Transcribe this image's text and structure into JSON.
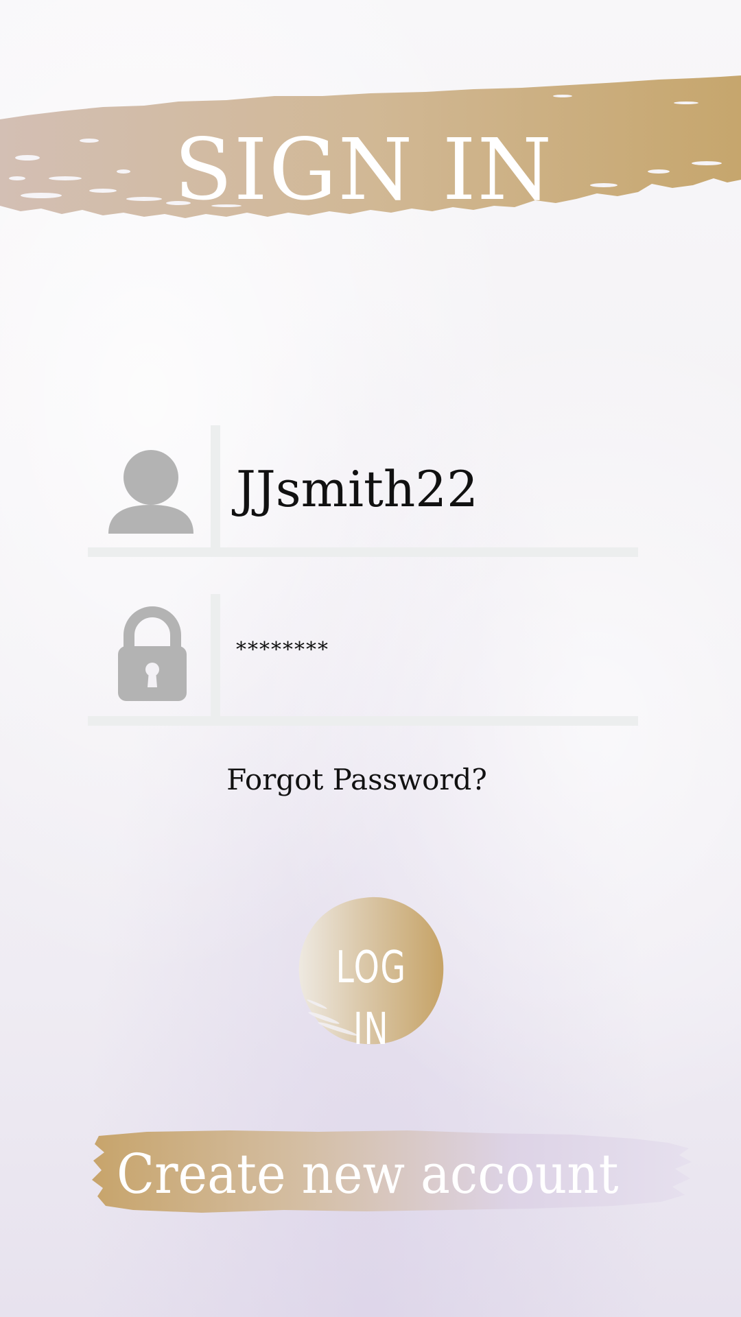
{
  "header": {
    "title": "SIGN IN"
  },
  "form": {
    "username": {
      "icon": "user-icon",
      "value": "JJsmith22"
    },
    "password": {
      "icon": "lock-icon",
      "value": "********"
    },
    "forgot_label": "Forgot Password?"
  },
  "actions": {
    "login_label": "LOG IN",
    "create_account_label": "Create new account"
  },
  "colors": {
    "gold": "#c9a76e",
    "taupe": "#d3bfae",
    "lavender": "#ddd4e8",
    "icon_gray": "#b3b3b3",
    "divider": "#eceeee"
  }
}
